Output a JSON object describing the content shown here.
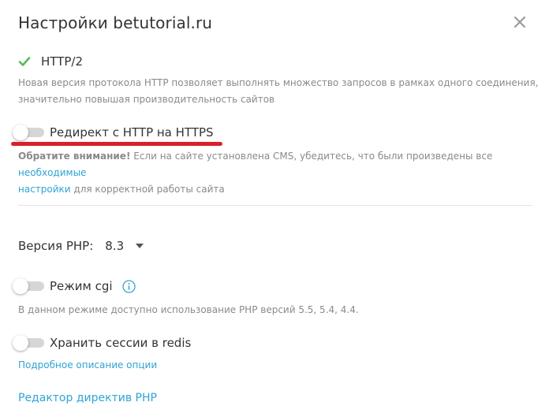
{
  "dialog": {
    "title": "Настройки betutorial.ru",
    "close_icon": "close-icon"
  },
  "http2": {
    "label": "HTTP/2",
    "enabled": true,
    "check_color": "#5cb85c",
    "description_line1": "Новая версия протокола HTTP позволяет выполнять множество запросов в рамках одного соединения,",
    "description_line2": "значительно повышая производительность сайтов"
  },
  "redirect": {
    "label": "Редирект с HTTP на HTTPS",
    "enabled": false,
    "highlight_color": "#d9202a",
    "warning_bold": "Обратите внимание!",
    "warning_text": " Если на сайте установлена CMS, убедитесь, что были произведены все ",
    "warning_link_part1": "необходимые",
    "warning_link_part2": "настройки",
    "warning_tail": " для корректной работы сайта"
  },
  "php": {
    "label": "Версия PHP:",
    "value": "8.3"
  },
  "cgi": {
    "label": "Режим cgi",
    "enabled": false,
    "description": "В данном режиме доступно использование PHP версий 5.5, 5.4, 4.4."
  },
  "redis": {
    "label": "Хранить сессии в redis",
    "enabled": false,
    "link": "Подробное описание опции"
  },
  "php_editor_link": "Редактор директив PHP",
  "colors": {
    "link": "#2fa4d4",
    "toggle_off": "#d6d6d6"
  }
}
